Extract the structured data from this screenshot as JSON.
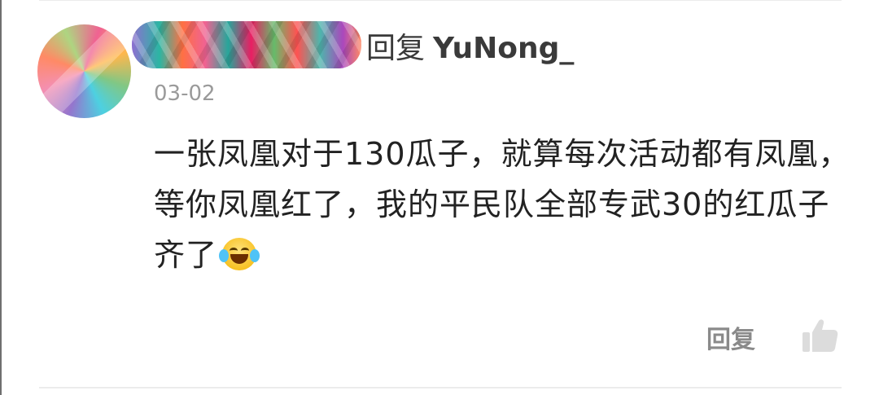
{
  "comment": {
    "reply_verb": "回复",
    "reply_target": "YuNong_",
    "date": "03-02",
    "text": "一张凤凰对于130瓜子，就算每次活动都有凤凰，等你凤凰红了，我的平民队全部专武30的红瓜子齐了",
    "emoji": "laughing-with-tears-emoji"
  },
  "actions": {
    "reply_label": "回复",
    "like_icon": "thumbs-up-icon"
  },
  "colors": {
    "text_primary": "#222222",
    "text_secondary": "#9a9a9a",
    "action_gray": "#8a8a8a",
    "divider": "#ececec"
  }
}
